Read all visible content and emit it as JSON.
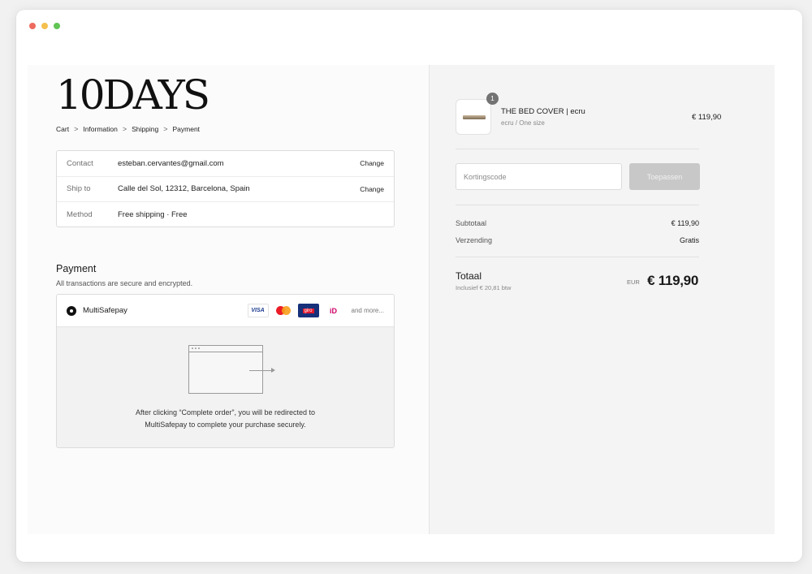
{
  "brand": {
    "logo_text": "10DAYS"
  },
  "breadcrumb": {
    "items": [
      "Cart",
      "Information",
      "Shipping",
      "Payment"
    ],
    "separator": ">"
  },
  "review": {
    "rows": [
      {
        "label": "Contact",
        "value": "esteban.cervantes@gmail.com",
        "action": "Change"
      },
      {
        "label": "Ship to",
        "value": "Calle del Sol, 12312, Barcelona, Spain",
        "action": "Change"
      },
      {
        "label": "Method",
        "value": "Free shipping · Free",
        "action": ""
      }
    ]
  },
  "payment": {
    "title": "Payment",
    "subtitle": "All transactions are secure and encrypted.",
    "method_name": "MultiSafepay",
    "cards": {
      "visa": "VISA",
      "giropay": "giro",
      "ideal": "iD"
    },
    "more_text": "and more...",
    "redirect_line1": "After clicking “Complete order”, you will be redirected to",
    "redirect_line2": "MultiSafepay to complete your purchase securely."
  },
  "order": {
    "item": {
      "quantity": "1",
      "name": "THE BED COVER | ecru",
      "variant": "ecru / One size",
      "price": "€ 119,90"
    },
    "discount": {
      "placeholder": "Kortingscode",
      "button_label": "Toepassen"
    },
    "subtotal_label": "Subtotaal",
    "subtotal_value": "€ 119,90",
    "shipping_label": "Verzending",
    "shipping_value": "Gratis",
    "total_label": "Totaal",
    "total_sub": "Inclusief € 20,81 btw",
    "total_currency": "EUR",
    "total_value": "€ 119,90"
  },
  "colors": {
    "window_bg": "#ffffff",
    "summary_bg": "#f4f4f4",
    "button_disabled": "#c8c8c8",
    "traffic_red": "#ee6a5e",
    "traffic_yellow": "#f5bf4f",
    "traffic_green": "#61c554"
  }
}
